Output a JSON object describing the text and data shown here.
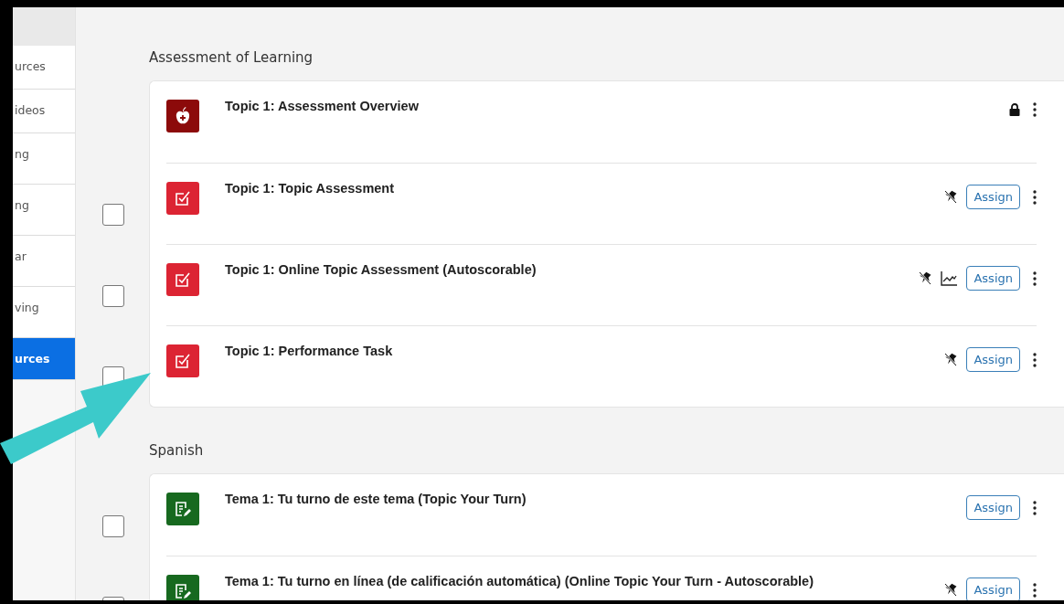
{
  "sidebar": {
    "items": [
      {
        "label": "urces",
        "selected": false
      },
      {
        "label": "ideos",
        "selected": false
      },
      {
        "label": "ng",
        "selected": false
      },
      {
        "label": "ng",
        "selected": false
      },
      {
        "label": "ar",
        "selected": false
      },
      {
        "label": "ving",
        "selected": false
      },
      {
        "label": "urces",
        "selected": true
      }
    ]
  },
  "sections": [
    {
      "title": "Assessment of Learning",
      "items": [
        {
          "kind": "overview",
          "title": "Topic 1: Assessment Overview",
          "locked": true,
          "pin_off": false,
          "chart": false
        },
        {
          "kind": "assessment",
          "title": "Topic 1: Topic Assessment",
          "checked": false,
          "locked": false,
          "pin_off": true,
          "chart": false,
          "assign": "Assign"
        },
        {
          "kind": "assessment",
          "title": "Topic 1: Online Topic Assessment (Autoscorable)",
          "checked": false,
          "locked": false,
          "pin_off": true,
          "chart": true,
          "assign": "Assign"
        },
        {
          "kind": "assessment",
          "title": "Topic 1: Performance Task",
          "checked": false,
          "locked": false,
          "pin_off": true,
          "chart": false,
          "assign": "Assign"
        }
      ]
    },
    {
      "title": "Spanish",
      "items": [
        {
          "kind": "practice",
          "title": "Tema 1: Tu turno de este tema (Topic Your Turn)",
          "checked": false,
          "locked": false,
          "pin_off": false,
          "chart": false,
          "assign": "Assign"
        },
        {
          "kind": "practice",
          "title": "Tema 1: Tu turno en línea (de calificación automática) (Online Topic Your Turn - Autoscorable)",
          "checked": false,
          "locked": false,
          "pin_off": true,
          "chart": false,
          "assign": "Assign"
        }
      ]
    }
  ]
}
